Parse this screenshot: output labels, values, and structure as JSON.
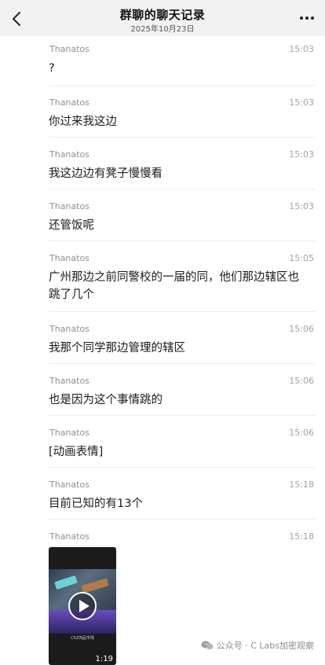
{
  "header": {
    "title": "群聊的聊天记录",
    "date": "2025年10月23日"
  },
  "messages": [
    {
      "sender": "Thanatos",
      "time": "15:03",
      "text": "?"
    },
    {
      "sender": "Thanatos",
      "time": "15:03",
      "text": "你过来我这边"
    },
    {
      "sender": "Thanatos",
      "time": "15:03",
      "text": "我这边边有凳子慢慢看"
    },
    {
      "sender": "Thanatos",
      "time": "15:03",
      "text": "还管饭呢"
    },
    {
      "sender": "Thanatos",
      "time": "15:05",
      "text": "广州那边之前同警校的一届的同，他们那边辖区也跳了几个"
    },
    {
      "sender": "Thanatos",
      "time": "15:06",
      "text": "我那个同学那边管理的辖区"
    },
    {
      "sender": "Thanatos",
      "time": "15:06",
      "text": "也是因为这个事情跳的"
    },
    {
      "sender": "Thanatos",
      "time": "15:06",
      "text": "[动画表情]"
    },
    {
      "sender": "Thanatos",
      "time": "15:18",
      "text": "目前已知的有13个"
    },
    {
      "sender": "Thanatos",
      "time": "15:18",
      "video": {
        "caption": "CS2饰品市场",
        "duration": "1:19"
      }
    }
  ],
  "watermark": {
    "text": "公众号 · C Labs加密观察",
    "icon": "wechat-icon"
  }
}
